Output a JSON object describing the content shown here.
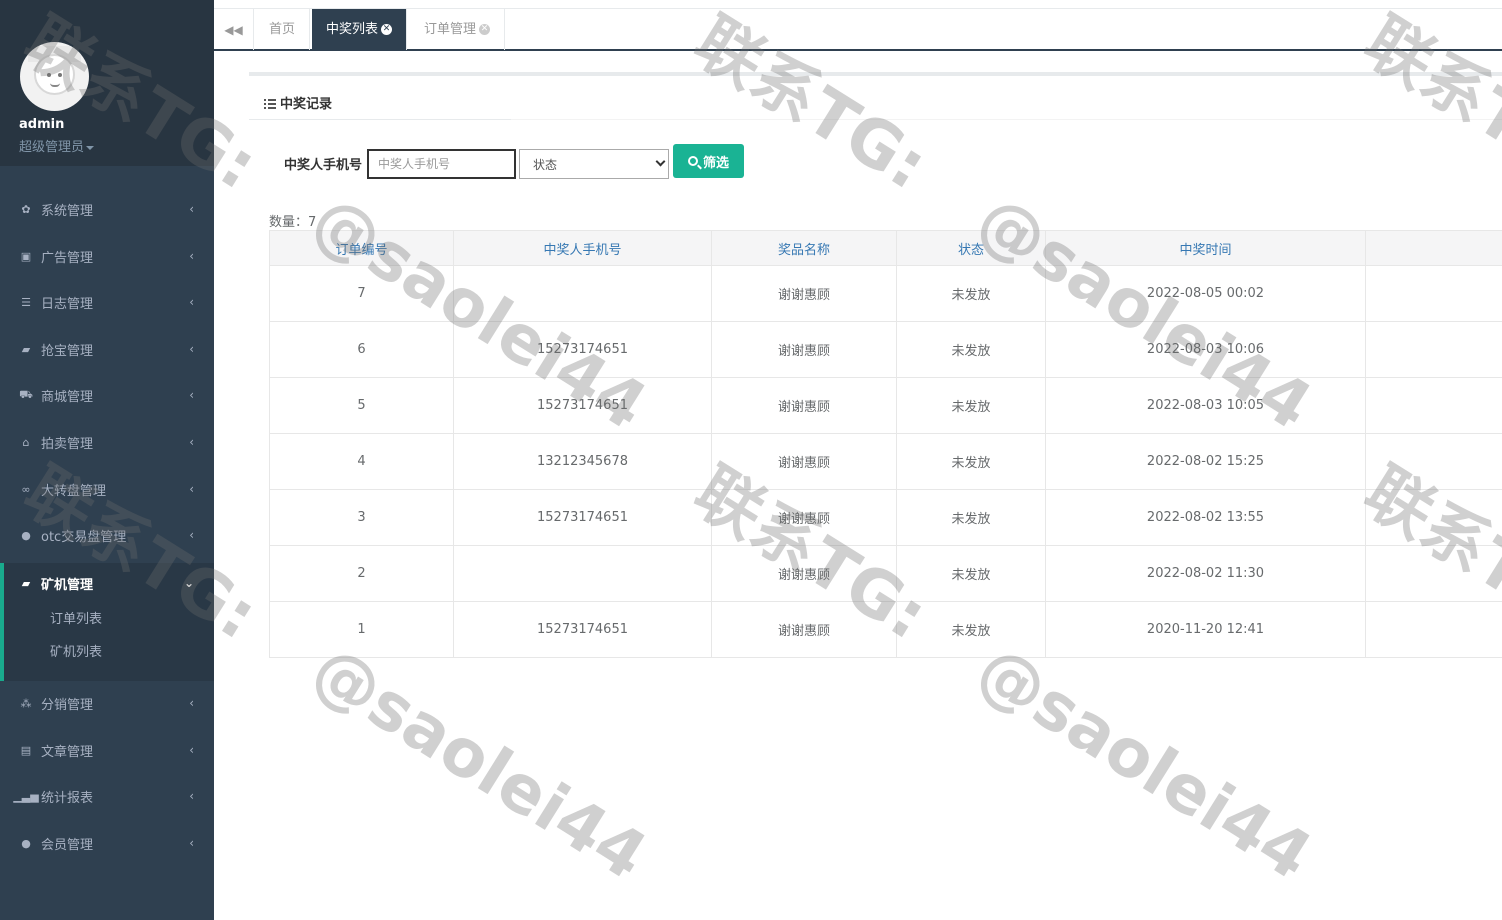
{
  "profile": {
    "name": "admin",
    "role": "超级管理员"
  },
  "sidebar": {
    "items": [
      {
        "label": "系统管理",
        "icon": "gear-icon"
      },
      {
        "label": "广告管理",
        "icon": "image-icon"
      },
      {
        "label": "日志管理",
        "icon": "list-icon"
      },
      {
        "label": "抢宝管理",
        "icon": "book-icon"
      },
      {
        "label": "商城管理",
        "icon": "cart-icon"
      },
      {
        "label": "拍卖管理",
        "icon": "bank-icon"
      },
      {
        "label": "大转盘管理",
        "icon": "gamepad-icon"
      },
      {
        "label": "otc交易盘管理",
        "icon": "user-icon"
      },
      {
        "label": "矿机管理",
        "icon": "book-icon"
      },
      {
        "label": "分销管理",
        "icon": "cubes-icon"
      },
      {
        "label": "文章管理",
        "icon": "archive-icon"
      },
      {
        "label": "统计报表",
        "icon": "signal-icon"
      },
      {
        "label": "会员管理",
        "icon": "user-icon"
      }
    ],
    "submenu": [
      "订单列表",
      "矿机列表"
    ]
  },
  "tabs": [
    {
      "label": "首页",
      "active": false,
      "closable": false
    },
    {
      "label": "中奖列表",
      "active": true,
      "closable": true
    },
    {
      "label": "订单管理",
      "active": false,
      "closable": true
    }
  ],
  "panel": {
    "title": "中奖记录"
  },
  "filter": {
    "label": "中奖人手机号",
    "phone_placeholder": "中奖人手机号",
    "status_value": "状态",
    "button_label": "筛选"
  },
  "count": {
    "label": "数量",
    "value": "7"
  },
  "table": {
    "headers": [
      "订单编号",
      "中奖人手机号",
      "奖品名称",
      "状态",
      "中奖时间",
      ""
    ],
    "rows": [
      [
        "7",
        "",
        "谢谢惠顾",
        "未发放",
        "2022-08-05 00:02",
        ""
      ],
      [
        "6",
        "15273174651",
        "谢谢惠顾",
        "未发放",
        "2022-08-03 10:06",
        ""
      ],
      [
        "5",
        "15273174651",
        "谢谢惠顾",
        "未发放",
        "2022-08-03 10:05",
        ""
      ],
      [
        "4",
        "13212345678",
        "谢谢惠顾",
        "未发放",
        "2022-08-02 15:25",
        ""
      ],
      [
        "3",
        "15273174651",
        "谢谢惠顾",
        "未发放",
        "2022-08-02 13:55",
        ""
      ],
      [
        "2",
        "",
        "谢谢惠顾",
        "未发放",
        "2022-08-02 11:30",
        ""
      ],
      [
        "1",
        "15273174651",
        "谢谢惠顾",
        "未发放",
        "2020-11-20 12:41",
        ""
      ]
    ]
  },
  "watermark": {
    "line1": "联系TG:",
    "line2": "@saolei44"
  },
  "colors": {
    "sidebar": "#2f4050",
    "accent": "#1ab394",
    "header_text": "#3678b3"
  }
}
